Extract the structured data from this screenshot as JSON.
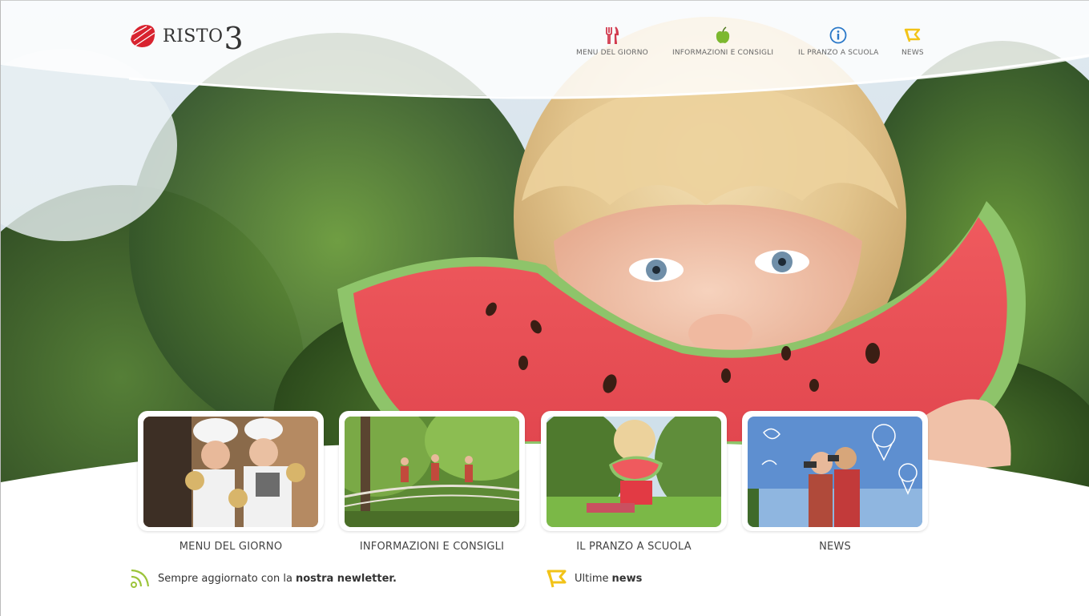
{
  "brand": {
    "name": "RISTO",
    "number": "3"
  },
  "nav": [
    {
      "label": "MENU DEL GIORNO",
      "icon": "fork-knife-icon",
      "color": "#d23a4e"
    },
    {
      "label": "INFORMAZIONI E CONSIGLI",
      "icon": "apple-icon",
      "color": "#7cb82f"
    },
    {
      "label": "IL PRANZO A SCUOLA",
      "icon": "info-icon",
      "color": "#2a78c8"
    },
    {
      "label": "NEWS",
      "icon": "flag-icon",
      "color": "#f2c318"
    }
  ],
  "tiles": [
    {
      "label": "MENU DEL GIORNO",
      "image": "chefs-photo"
    },
    {
      "label": "INFORMAZIONI E CONSIGLI",
      "image": "forest-adventure-photo"
    },
    {
      "label": "IL PRANZO A SCUOLA",
      "image": "child-watermelon-photo"
    },
    {
      "label": "NEWS",
      "image": "kids-binoculars-photo"
    }
  ],
  "footer": {
    "newsletter_prefix": "Sempre aggiornato con la",
    "newsletter_bold": "nostra newletter.",
    "news_prefix": "Ultime",
    "news_bold": "news"
  },
  "colors": {
    "red": "#d23a4e",
    "green": "#7cb82f",
    "blue": "#2a78c8",
    "yellow": "#f2c318",
    "footer_green": "#9cc43b"
  }
}
